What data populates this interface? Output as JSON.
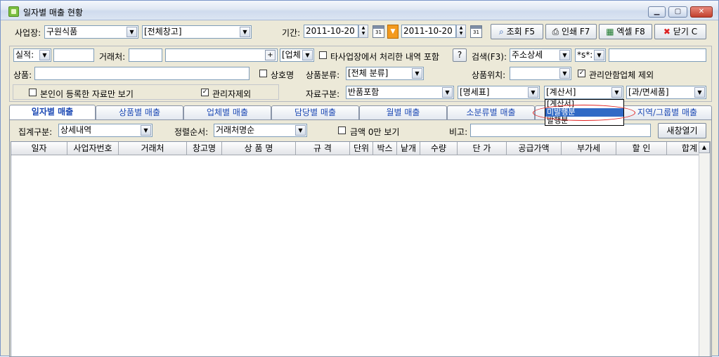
{
  "window": {
    "title": "일자별 매출 현황",
    "controls": [
      "▁",
      "▢",
      "✕"
    ]
  },
  "row1": {
    "business_label": "사업장:",
    "business_value": "구원식품",
    "warehouse_value": "[전체창고]",
    "period_label": "기간:",
    "date_from": "2011-10-20",
    "date_to": "2011-10-20",
    "cal_text": "31",
    "buttons": {
      "search": "조회 F5",
      "print": "인쇄 F7",
      "excel": "엑셀 F8",
      "close": "닫기 C"
    }
  },
  "row2": {
    "actual_label": "실적:",
    "client_label": "거래처:",
    "plus": "+",
    "client_type": "[업체",
    "other_biz_label": "타사업장에서 처리한 내역 포함",
    "help": "?",
    "search_label": "검색(F3):",
    "search_type": "주소상세",
    "wildcard": "*s*:"
  },
  "row3": {
    "product_label": "상품:",
    "trade_name_label": "상호명",
    "category_label": "상품분류:",
    "category_value": "[전체 분류]",
    "location_label": "상품위치:",
    "exclude_label": "관리안함업체 제외"
  },
  "row4": {
    "own_only_label": "본인이 등록한 자료만 보기",
    "admin_exclude_label": "관리자제외",
    "data_type_label": "자료구분:",
    "data_type_value": "반품포함",
    "statement_value": "[명세표]",
    "invoice_value": "[계산서]",
    "tax_value": "[과/면세품]"
  },
  "invoice_dropdown": {
    "options": [
      "[계산서]",
      "미발행분",
      "발행분"
    ],
    "highlighted": 1
  },
  "tabs": [
    "일자별 매출",
    "상품별 매출",
    "업체별 매출",
    "담당별 매출",
    "월별 매출",
    "소분류별 매출",
    "",
    "지역/그룹별 매출"
  ],
  "row5": {
    "group_label": "집계구분:",
    "group_value": "상세내역",
    "sort_label": "정렬순서:",
    "sort_value": "거래처명순",
    "amount_label": "금액 0만 보기",
    "note_label": "비고:",
    "new_window": "새창열기"
  },
  "columns": [
    "일자",
    "사업자번호",
    "거래처",
    "창고명",
    "상 품 명",
    "규 격",
    "단위",
    "박스",
    "낱개",
    "수량",
    "단 가",
    "공급가액",
    "부가세",
    "할 인",
    "합계"
  ]
}
